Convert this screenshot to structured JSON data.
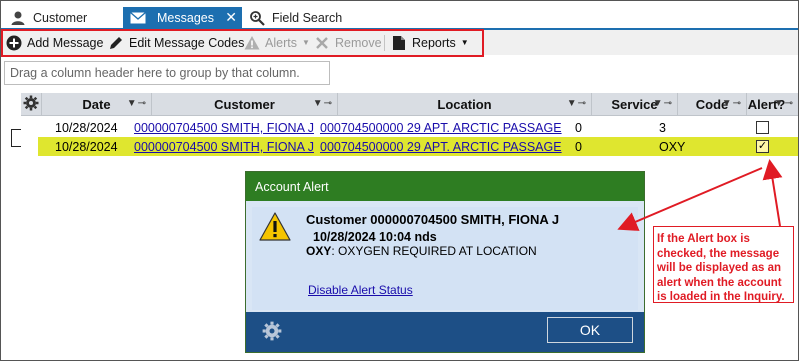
{
  "tabs": [
    {
      "label": "Customer",
      "icon": "user-icon"
    },
    {
      "label": "Messages",
      "icon": "envelope-icon",
      "active": true
    },
    {
      "label": "Field Search",
      "icon": "magnifier-icon"
    }
  ],
  "toolbar": {
    "add_label": "Add Message",
    "edit_label": "Edit Message Codes",
    "alerts_label": "Alerts",
    "remove_label": "Remove",
    "reports_label": "Reports"
  },
  "group_panel": {
    "text": "Drag a column header here to group by that column."
  },
  "grid": {
    "columns": [
      "Date",
      "Customer",
      "Location",
      "Service",
      "Code",
      "Alert?"
    ],
    "rows": [
      {
        "date": "10/28/2024",
        "customer": "000000704500 SMITH, FIONA J",
        "location": "000704500000  29 APT. ARCTIC PASSAGE",
        "service": "0",
        "code": "3",
        "alert": false
      },
      {
        "date": "10/28/2024",
        "customer": "000000704500 SMITH, FIONA J",
        "location": "000704500000  29 APT. ARCTIC PASSAGE",
        "service": "0",
        "code": "OXY",
        "alert": true
      }
    ]
  },
  "dialog": {
    "title": "Account Alert",
    "customer_line": "Customer 000000704500 SMITH, FIONA J",
    "date_line": "10/28/2024 10:04 nds",
    "code": "OXY",
    "message": ": OXYGEN REQUIRED AT LOCATION",
    "link": "Disable Alert Status",
    "ok_label": "OK"
  },
  "annotation": {
    "text": "If the Alert box is checked, the message will be displayed as an alert when the account is loaded in the Inquiry."
  },
  "colors": {
    "tab_active": "#1d6fb0",
    "highlight_row": "#dfe62f",
    "dialog_title": "#2e7d22",
    "dialog_footer": "#1d4f86",
    "annotation_red": "#e01b24"
  }
}
